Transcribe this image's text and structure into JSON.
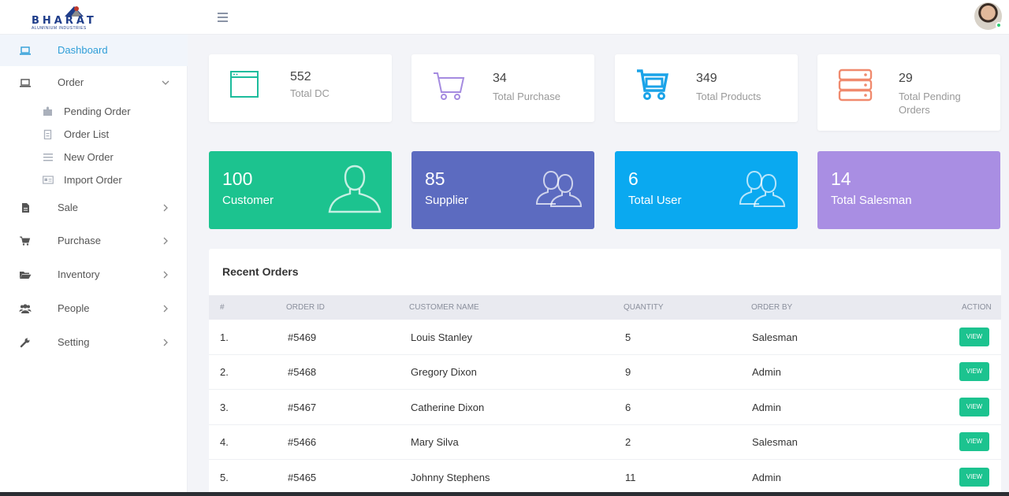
{
  "brand": {
    "logo_text": "BHARAT",
    "logo_subtext": "ALUMINIUM INDUSTRIES"
  },
  "sidebar": {
    "dashboard": "Dashboard",
    "order": "Order",
    "order_sub": [
      "Pending Order",
      "Order List",
      "New Order",
      "Import Order"
    ],
    "sale": "Sale",
    "purchase": "Purchase",
    "inventory": "Inventory",
    "people": "People",
    "setting": "Setting"
  },
  "stats": [
    {
      "value": "552",
      "label": "Total DC",
      "icon": "browser-window-icon",
      "color": "#1cbc9c"
    },
    {
      "value": "34",
      "label": "Total Purchase",
      "icon": "shopping-cart-icon",
      "color": "#a58be0"
    },
    {
      "value": "349",
      "label": "Total Products",
      "icon": "basket-cart-icon",
      "color": "#1aa3e8"
    },
    {
      "value": "29",
      "label": "Total Pending Orders",
      "icon": "server-drive-icon",
      "color": "#f08a6e"
    }
  ],
  "color_cards": [
    {
      "value": "100",
      "label": "Customer",
      "icon": "user-icon",
      "color": "#1cc38f"
    },
    {
      "value": "85",
      "label": "Supplier",
      "icon": "users-icon",
      "color": "#5c6bc0"
    },
    {
      "value": "6",
      "label": "Total User",
      "icon": "users-icon",
      "color": "#0aa9f0"
    },
    {
      "value": "14",
      "label": "Total Salesman",
      "icon": "none",
      "color": "#a98ee3"
    }
  ],
  "orders": {
    "title": "Recent Orders",
    "columns": [
      "#",
      "ORDER ID",
      "CUSTOMER NAME",
      "QUANTITY",
      "ORDER BY",
      "ACTION"
    ],
    "rows": [
      {
        "num": "1.",
        "id": "#5469",
        "customer": "Louis Stanley",
        "qty": "5",
        "by": "Salesman"
      },
      {
        "num": "2.",
        "id": "#5468",
        "customer": "Gregory Dixon",
        "qty": "9",
        "by": "Admin"
      },
      {
        "num": "3.",
        "id": "#5467",
        "customer": "Catherine Dixon",
        "qty": "6",
        "by": "Admin"
      },
      {
        "num": "4.",
        "id": "#5466",
        "customer": "Mary Silva",
        "qty": "2",
        "by": "Salesman"
      },
      {
        "num": "5.",
        "id": "#5465",
        "customer": "Johnny Stephens",
        "qty": "11",
        "by": "Admin"
      }
    ],
    "action_label": "VIEW"
  }
}
